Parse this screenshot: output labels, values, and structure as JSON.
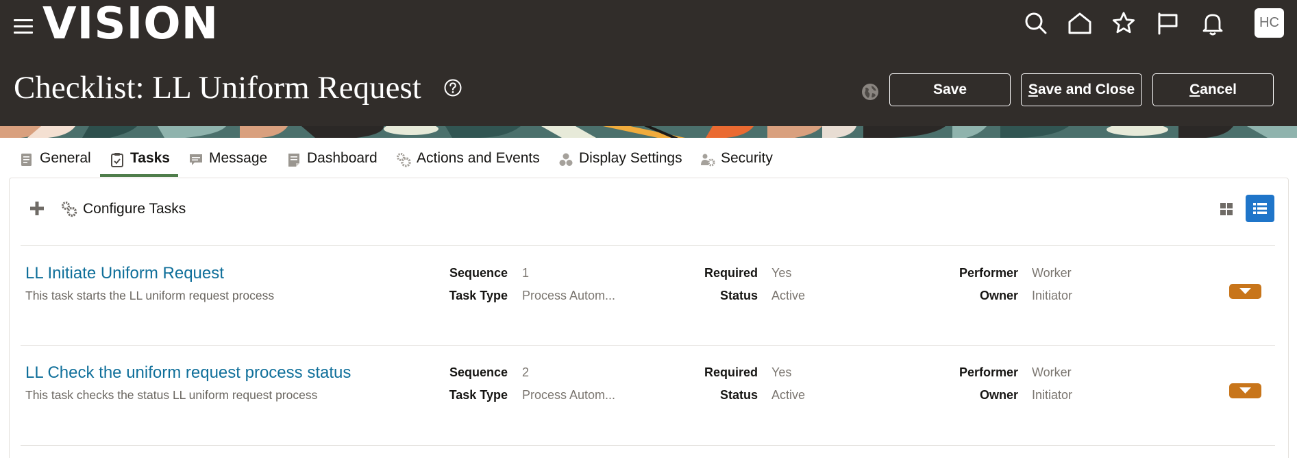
{
  "header": {
    "logo": "VISION",
    "avatar_initials": "HC",
    "icons": [
      "search-icon",
      "home-icon",
      "star-icon",
      "flag-icon",
      "bell-icon"
    ],
    "title": "Checklist: LL Uniform Request",
    "buttons": {
      "save": "Save",
      "save_and_close": "Save and Close",
      "cancel": "Cancel"
    },
    "colors": {
      "bar": "#312d2a",
      "button_border": "#ffffff"
    }
  },
  "tabs": [
    {
      "label": "General",
      "icon": "document-icon",
      "active": false
    },
    {
      "label": "Tasks",
      "icon": "clipboard-icon",
      "active": true
    },
    {
      "label": "Message",
      "icon": "message-icon",
      "active": false
    },
    {
      "label": "Dashboard",
      "icon": "dashboard-icon",
      "active": false
    },
    {
      "label": "Actions and Events",
      "icon": "gears-icon",
      "active": false
    },
    {
      "label": "Display Settings",
      "icon": "circles-icon",
      "active": false
    },
    {
      "label": "Security",
      "icon": "security-gear-icon",
      "active": false
    }
  ],
  "toolbar": {
    "configure_label": "Configure Tasks",
    "active_view": "list"
  },
  "field_labels": {
    "sequence": "Sequence",
    "task_type": "Task Type",
    "required": "Required",
    "status": "Status",
    "performer": "Performer",
    "owner": "Owner"
  },
  "tasks": [
    {
      "title": "LL Initiate Uniform Request",
      "description": "This task starts the LL uniform request process",
      "sequence": "1",
      "task_type": "Process Autom...",
      "required": "Yes",
      "status": "Active",
      "performer": "Worker",
      "owner": "Initiator"
    },
    {
      "title": "LL Check the uniform request process status",
      "description": "This task checks the status LL uniform request process",
      "sequence": "2",
      "task_type": "Process Autom...",
      "required": "Yes",
      "status": "Active",
      "performer": "Worker",
      "owner": "Initiator"
    }
  ],
  "colors": {
    "link": "#0f6f9a",
    "active_tab_underline": "#4f7d4b",
    "menu_button": "#c8751a",
    "list_view_button": "#1f75c9"
  }
}
